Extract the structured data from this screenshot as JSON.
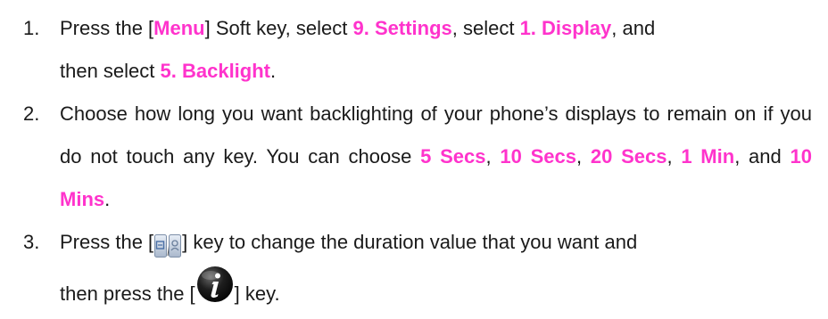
{
  "steps": [
    {
      "number": "1.",
      "parts": {
        "a": "Press the [",
        "menu": "Menu",
        "b": "] Soft key, select ",
        "settings": "9. Settings",
        "c": ", select ",
        "display": "1. Display",
        "d": ", and",
        "e": "then select ",
        "backlight": "5. Backlight",
        "f": "."
      }
    },
    {
      "number": "2.",
      "parts": {
        "a": "Choose how long you want backlighting of your phone’s displays to remain on if you do not touch any key. You can choose ",
        "opt1a": "5 Secs",
        "b": ", ",
        "opt2": "10 Secs",
        "c": ", ",
        "opt3": "20 Secs",
        "d": ", ",
        "opt4": "1 Min",
        "e": ", and ",
        "opt5": "10 Mins",
        "f": "."
      }
    },
    {
      "number": "3.",
      "parts": {
        "a": "Press the [",
        "b": "] key to change the duration value that you want and",
        "c": "then press the [",
        "d": "] key."
      },
      "icons": {
        "nav": "left-right-nav-key-icon",
        "ok": "info-ok-key-icon"
      }
    }
  ],
  "colors": {
    "highlight": "#ff33cc",
    "text": "#1a1a1a"
  }
}
